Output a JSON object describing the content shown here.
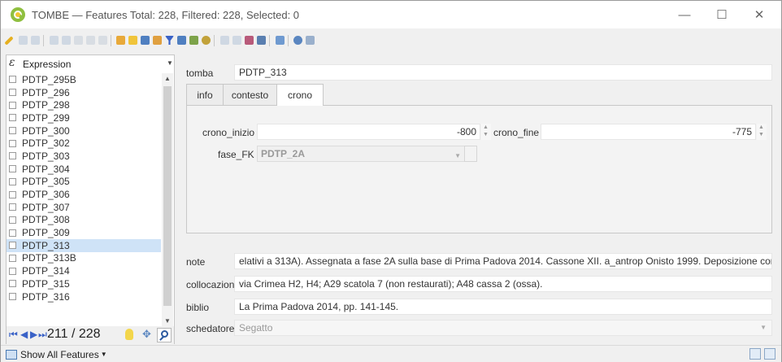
{
  "window": {
    "title": "TOMBE — Features Total: 228, Filtered: 228, Selected: 0",
    "minimize_glyph": "—",
    "maximize_glyph": "☐",
    "close_glyph": "✕"
  },
  "colors": {
    "accent": "#3a62c7",
    "selection": "#cfe3f7",
    "qgis_green": "#8fbf3f"
  },
  "left_panel": {
    "expression_label": "Expression",
    "expression_icon": "ε",
    "items": [
      {
        "label": "PDTP_295B",
        "selected": false
      },
      {
        "label": "PDTP_296",
        "selected": false
      },
      {
        "label": "PDTP_298",
        "selected": false
      },
      {
        "label": "PDTP_299",
        "selected": false
      },
      {
        "label": "PDTP_300",
        "selected": false
      },
      {
        "label": "PDTP_302",
        "selected": false
      },
      {
        "label": "PDTP_303",
        "selected": false
      },
      {
        "label": "PDTP_304",
        "selected": false
      },
      {
        "label": "PDTP_305",
        "selected": false
      },
      {
        "label": "PDTP_306",
        "selected": false
      },
      {
        "label": "PDTP_307",
        "selected": false
      },
      {
        "label": "PDTP_308",
        "selected": false
      },
      {
        "label": "PDTP_309",
        "selected": false
      },
      {
        "label": "PDTP_313",
        "selected": true
      },
      {
        "label": "PDTP_313B",
        "selected": false
      },
      {
        "label": "PDTP_314",
        "selected": false
      },
      {
        "label": "PDTP_315",
        "selected": false
      },
      {
        "label": "PDTP_316",
        "selected": false
      }
    ],
    "nav_count": "211 / 228"
  },
  "form": {
    "tomba_label": "tomba",
    "tomba_value": "PDTP_313",
    "tabs": [
      {
        "label": "info",
        "active": false
      },
      {
        "label": "contesto",
        "active": false
      },
      {
        "label": "crono",
        "active": true
      }
    ],
    "crono_inizio_label": "crono_inizio",
    "crono_inizio_value": "-800",
    "crono_fine_label": "crono_fine",
    "crono_fine_value": "-775",
    "fase_fk_label": "fase_FK",
    "fase_fk_value": "PDTP_2A",
    "note_label": "note",
    "note_value": "elativi a 313A). Assegnata a fase 2A sulla base di Prima Padova 2014. Cassone XII. a_antrop Onisto 1999. Deposizione contestuale.",
    "collocazione_label": "collocazione",
    "collocazione_value": "via Crimea H2, H4; A29 scatola 7 (non restaurati);  A48 cassa 2 (ossa).",
    "biblio_label": "biblio",
    "biblio_value": "La Prima Padova 2014, pp. 141-145.",
    "schedatore_label": "schedatore",
    "schedatore_value": "Segatto"
  },
  "status_bar": {
    "show_all_label": "Show All Features"
  }
}
